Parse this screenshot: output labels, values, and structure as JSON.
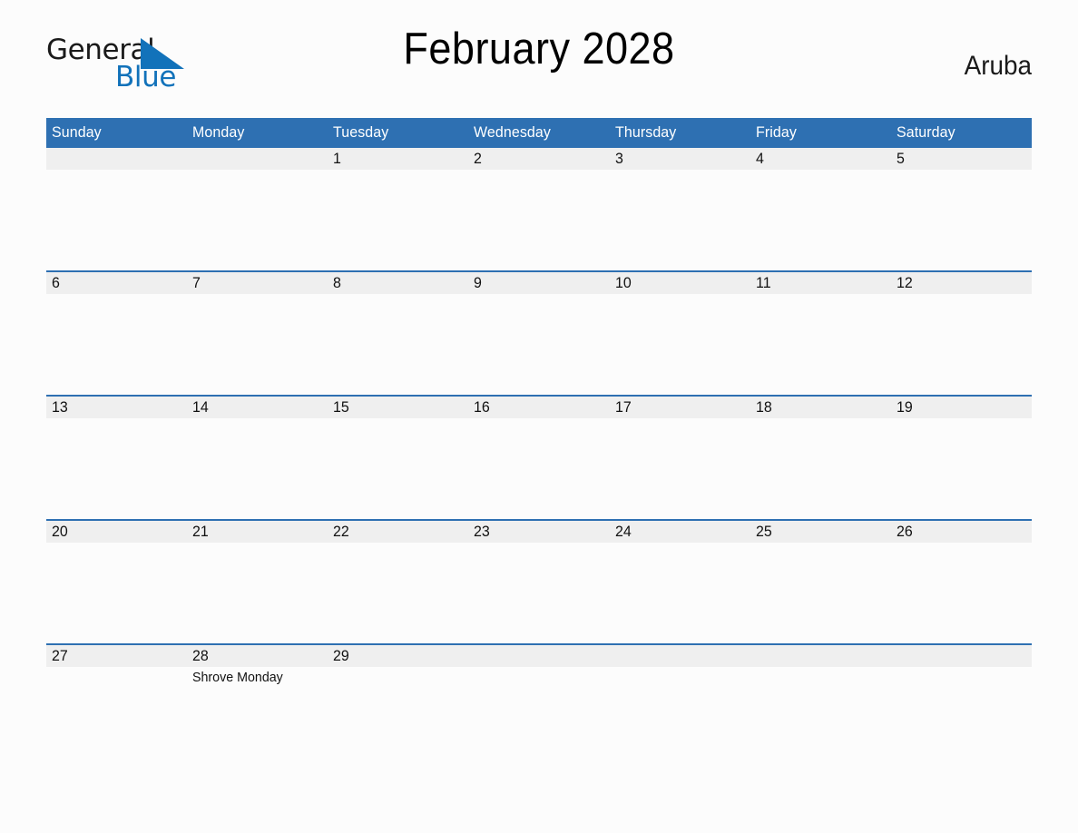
{
  "brand": {
    "name_part1": "General",
    "name_part2": "Blue",
    "triangle_icon": "triangle-logo-icon",
    "color": "#1272ba"
  },
  "header": {
    "title": "February 2028",
    "region": "Aruba"
  },
  "theme": {
    "accent_blue": "#2e70b2",
    "band_gray": "#efefef",
    "page_background": "#fcfcfc",
    "header_text": "#ffffff"
  },
  "calendar": {
    "weekday_headers": [
      "Sunday",
      "Monday",
      "Tuesday",
      "Wednesday",
      "Thursday",
      "Friday",
      "Saturday"
    ],
    "weeks": [
      [
        {
          "day": "",
          "events": []
        },
        {
          "day": "",
          "events": []
        },
        {
          "day": "1",
          "events": []
        },
        {
          "day": "2",
          "events": []
        },
        {
          "day": "3",
          "events": []
        },
        {
          "day": "4",
          "events": []
        },
        {
          "day": "5",
          "events": []
        }
      ],
      [
        {
          "day": "6",
          "events": []
        },
        {
          "day": "7",
          "events": []
        },
        {
          "day": "8",
          "events": []
        },
        {
          "day": "9",
          "events": []
        },
        {
          "day": "10",
          "events": []
        },
        {
          "day": "11",
          "events": []
        },
        {
          "day": "12",
          "events": []
        }
      ],
      [
        {
          "day": "13",
          "events": []
        },
        {
          "day": "14",
          "events": []
        },
        {
          "day": "15",
          "events": []
        },
        {
          "day": "16",
          "events": []
        },
        {
          "day": "17",
          "events": []
        },
        {
          "day": "18",
          "events": []
        },
        {
          "day": "19",
          "events": []
        }
      ],
      [
        {
          "day": "20",
          "events": []
        },
        {
          "day": "21",
          "events": []
        },
        {
          "day": "22",
          "events": []
        },
        {
          "day": "23",
          "events": []
        },
        {
          "day": "24",
          "events": []
        },
        {
          "day": "25",
          "events": []
        },
        {
          "day": "26",
          "events": []
        }
      ],
      [
        {
          "day": "27",
          "events": []
        },
        {
          "day": "28",
          "events": [
            "Shrove Monday"
          ]
        },
        {
          "day": "29",
          "events": []
        },
        {
          "day": "",
          "events": []
        },
        {
          "day": "",
          "events": []
        },
        {
          "day": "",
          "events": []
        },
        {
          "day": "",
          "events": []
        }
      ]
    ]
  }
}
